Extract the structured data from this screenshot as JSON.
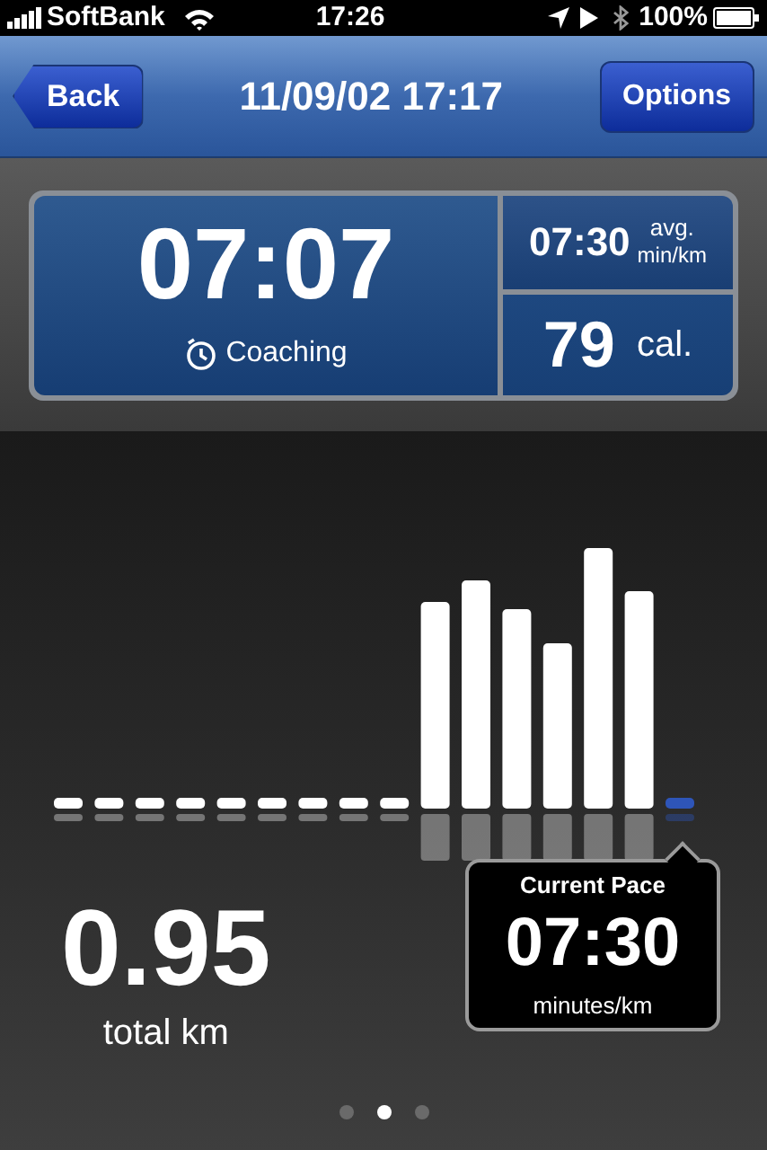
{
  "status_bar": {
    "carrier": "SoftBank",
    "time": "17:26",
    "battery": "100%"
  },
  "nav_bar": {
    "back": "Back",
    "title": "11/09/02 17:17",
    "options": "Options"
  },
  "stats": {
    "duration": "07:07",
    "coaching": "Coaching",
    "pace": "07:30",
    "pace_unit_top": "avg.",
    "pace_unit_bottom": "min/km",
    "calories": "79",
    "calories_unit": "cal."
  },
  "distance": {
    "value": "0.95",
    "unit": "total km"
  },
  "current_pace": {
    "title": "Current Pace",
    "value": "07:30",
    "unit": "minutes/km"
  },
  "page_dots": [
    {
      "selected": false
    },
    {
      "selected": true
    },
    {
      "selected": false
    }
  ]
}
